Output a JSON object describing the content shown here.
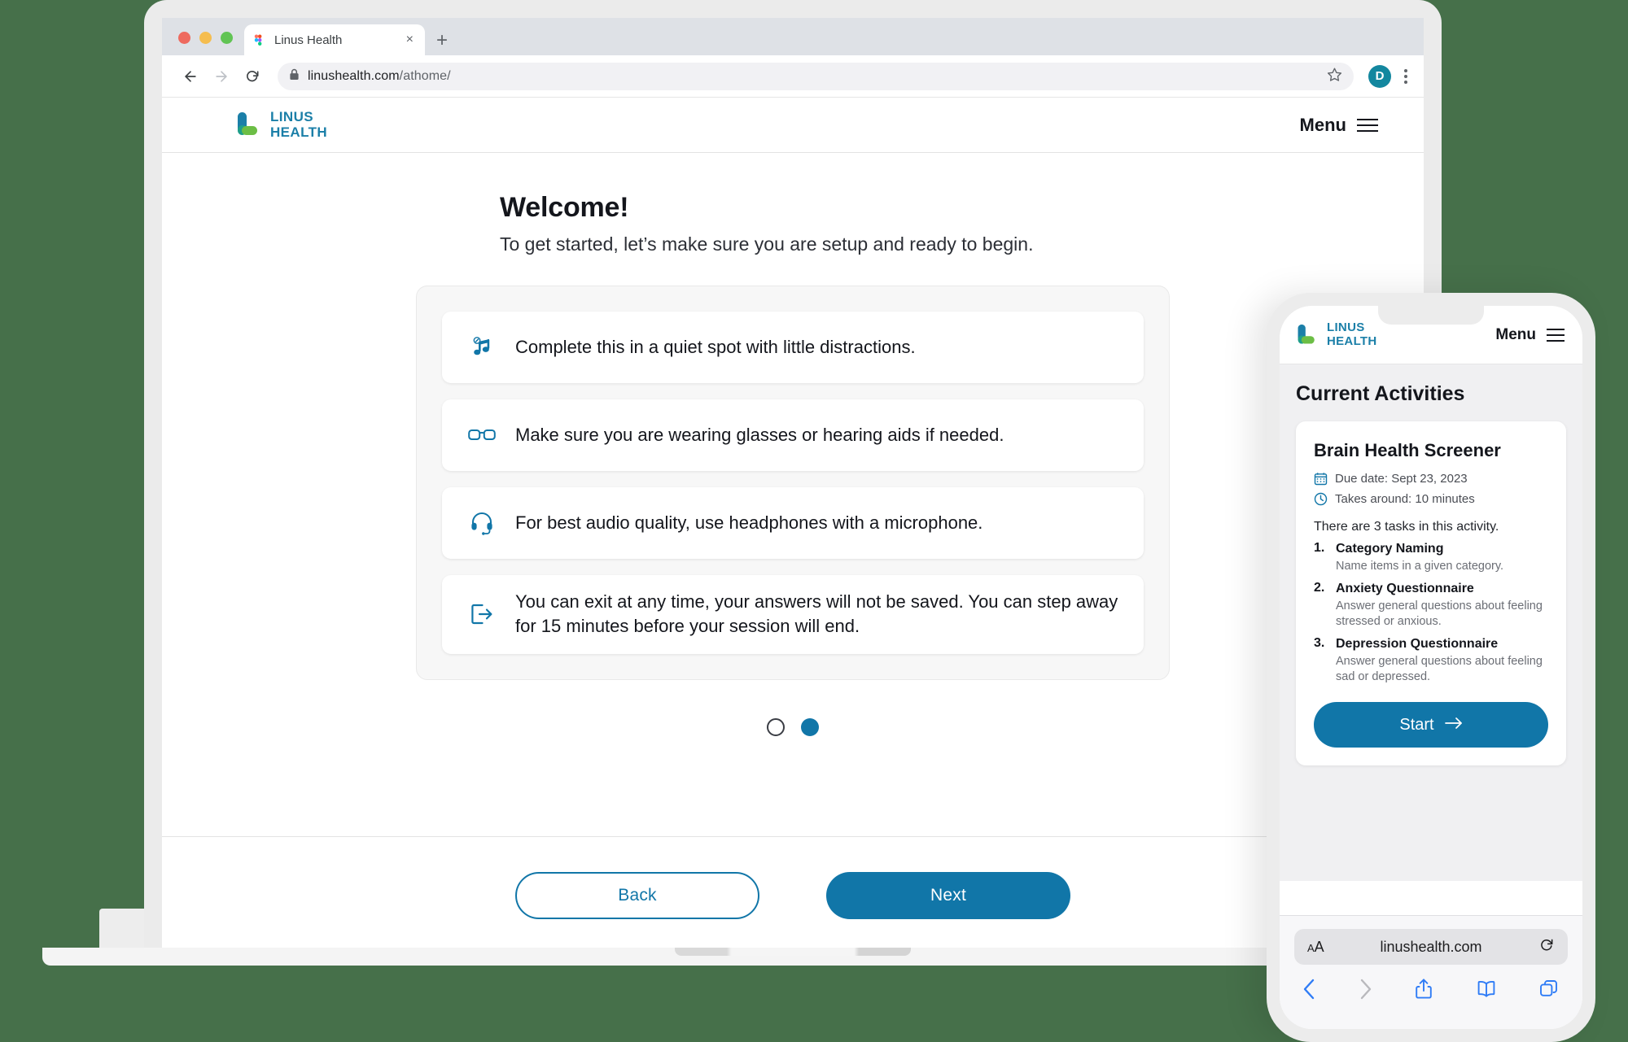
{
  "background_color": "#46704a",
  "accent_color": "#1176a8",
  "browser": {
    "tab": {
      "title": "Linus Health",
      "close_label": "×",
      "favicon_name": "figma-favicon"
    },
    "new_tab_label": "+",
    "url_prefix": "linushealth.com",
    "url_suffix": "/athome/",
    "profile_initial": "D",
    "traffic_lights": [
      "close",
      "minimize",
      "maximize"
    ]
  },
  "app_header": {
    "logo_line1": "LINUS",
    "logo_line2": "HEALTH",
    "menu_label": "Menu"
  },
  "welcome": {
    "title": "Welcome!",
    "subtitle": "To get started, let’s make sure you are setup and ready to begin.",
    "tips": [
      {
        "icon": "music-note-off-icon",
        "text": "Complete this in a quiet spot with little distractions."
      },
      {
        "icon": "glasses-icon",
        "text": "Make sure you are wearing glasses or hearing aids if needed."
      },
      {
        "icon": "headset-icon",
        "text": "For best audio quality, use headphones with a microphone."
      },
      {
        "icon": "exit-icon",
        "text": "You can exit at any time, your answers will not be saved. You can step away for 15 minutes before your session will end."
      }
    ],
    "pagination": {
      "total": 2,
      "current": 2
    },
    "back_label": "Back",
    "next_label": "Next"
  },
  "phone": {
    "header": {
      "logo_line1": "LINUS",
      "logo_line2": "HEALTH",
      "menu_label": "Menu"
    },
    "section_title": "Current Activities",
    "activity": {
      "title": "Brain Health Screener",
      "due_date": "Due date: Sept 23, 2023",
      "duration": "Takes around: 10 minutes",
      "tasks_intro": "There are 3 tasks in this activity.",
      "tasks": [
        {
          "name": "Category Naming",
          "desc": "Name items in a given category."
        },
        {
          "name": "Anxiety Questionnaire",
          "desc": "Answer general questions about feeling stressed or anxious."
        },
        {
          "name": "Depression Questionnaire",
          "desc": "Answer general questions about feeling sad or depressed."
        }
      ],
      "start_label": "Start"
    },
    "safari": {
      "text_size_label": "A",
      "text_size_small": "A",
      "url": "linushealth.com",
      "tools": [
        "back",
        "forward",
        "share",
        "bookmarks",
        "tabs"
      ]
    }
  }
}
